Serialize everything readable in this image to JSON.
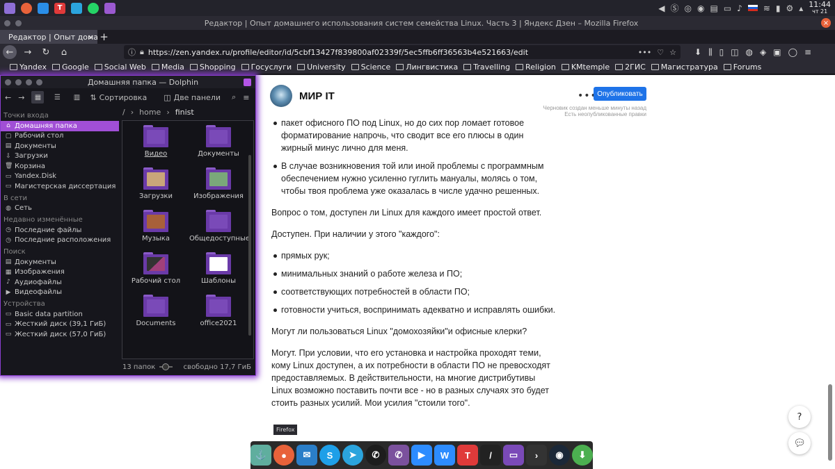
{
  "system_panel": {
    "clock_time": "11:44",
    "clock_day": "чт 21",
    "icons": [
      {
        "name": "app-menu-icon",
        "color": "#8e6fd6"
      },
      {
        "name": "firefox-icon",
        "color": "#e8623a"
      },
      {
        "name": "mail-icon",
        "color": "#2a8ee8"
      },
      {
        "name": "typora-icon",
        "color": "#e03a3a",
        "glyph": "T"
      },
      {
        "name": "telegram-icon",
        "color": "#2ba4dd"
      },
      {
        "name": "whatsapp-icon",
        "color": "#25d366"
      },
      {
        "name": "dolphin-icon",
        "color": "#9b59d0"
      }
    ]
  },
  "browser": {
    "window_title": "Редактор | Опыт домашнего использования систем семейства Linux. Часть 3 | Яндекс Дзен – Mozilla Firefox",
    "tab_title": "Редактор | Опыт домашнего",
    "url": "https://zen.yandex.ru/profile/editor/id/5cbf13427f839800af02339f/5ec5ffb6ff36563b4e521663/edit",
    "bookmarks": [
      "Yandex",
      "Google",
      "Social Web",
      "Media",
      "Shopping",
      "Госуслуги",
      "University",
      "Science",
      "Лингвистика",
      "Travelling",
      "Religion",
      "KMtemple",
      "2ГИС",
      "Магистратура",
      "Forums"
    ]
  },
  "page": {
    "site_name": "МИР IT",
    "publish_label": "Опубликовать",
    "draft_line1": "Черновик создан меньше минуты назад",
    "draft_line2": "Есть неопубликованные правки",
    "help_label": "?",
    "article": {
      "bullet_a": "пакет офисного ПО под Linux, но до сих пор ломает готовое форматирование напрочь, что сводит все его плюсы в один жирный минус лично для меня.",
      "bullet_b": "В случае возникновения той или иной проблемы с программным обеспечением нужно усиленно гуглить мануалы, молясь о том, чтобы твоя проблема уже оказалась в числе удачно решенных.",
      "p1": "Вопрос о том, доступен ли Linux для каждого имеет простой ответ.",
      "p2": "Доступен. При наличии у этого \"каждого\":",
      "list": [
        "прямых рук;",
        "минимальных знаний о работе железа и ПО;",
        "соответствующих потребностей в области ПО;",
        "готовности учиться, воспринимать адекватно и исправлять ошибки."
      ],
      "p3": "Могут ли пользоваться Linux \"домохозяйки\"и офисные клерки?",
      "p4": "Могут. При условии, что его установка и настройка проходят теми, кому Linux доступен, а их потребности в области ПО не превосходят предоставляемых. В действительности, на многие дистрибутивы Linux возможно поставить почти все - но в разных случаях это будет стоить разных усилий. Мои усилия \"стоили того\"."
    }
  },
  "dolphin": {
    "title": "Домашняя папка — Dolphin",
    "sort_label": "Сортировка",
    "split_label": "Две панели",
    "breadcrumb": {
      "root": "/",
      "home": "home",
      "current": "finist"
    },
    "sections": {
      "places": "Точки входа",
      "remote": "В сети",
      "recent": "Недавно изменённые",
      "search": "Поиск",
      "devices": "Устройства"
    },
    "places": [
      "Домашняя папка",
      "Рабочий стол",
      "Документы",
      "Загрузки",
      "Корзина",
      "Yandex.Disk",
      "Магистерская диссертация"
    ],
    "remote": [
      "Сеть"
    ],
    "recent": [
      "Последние файлы",
      "Последние расположения"
    ],
    "search": [
      "Документы",
      "Изображения",
      "Аудиофайлы",
      "Видеофайлы"
    ],
    "devices": [
      "Basic data partition",
      "Жесткий диск (39,1 ГиБ)",
      "Жесткий диск (57,0 ГиБ)"
    ],
    "files": [
      "Видео",
      "Документы",
      "Загрузки",
      "Изображения",
      "Музыка",
      "Общедоступные",
      "Рабочий стол",
      "Шаблоны",
      "Documents",
      "office2021"
    ],
    "status_count": "13 папок",
    "status_free": "свободно 17,7 ГиБ"
  },
  "tooltip": "Firefox",
  "dock": [
    {
      "name": "dock-anchor-icon",
      "color": "#5fae9e",
      "glyph": "⚓"
    },
    {
      "name": "dock-firefox-icon",
      "color": "#e8623a",
      "glyph": "●"
    },
    {
      "name": "dock-mail-icon",
      "color": "#2a7ec8",
      "glyph": "✉"
    },
    {
      "name": "dock-skype-icon",
      "color": "#1e9fe8",
      "glyph": "S"
    },
    {
      "name": "dock-telegram-icon",
      "color": "#2ba4dd",
      "glyph": "➤"
    },
    {
      "name": "dock-whatsapp-icon",
      "color": "#1d1d1d",
      "glyph": "✆"
    },
    {
      "name": "dock-viber-icon",
      "color": "#7b519d",
      "glyph": "✆"
    },
    {
      "name": "dock-zoom-icon",
      "color": "#2d8cff",
      "glyph": "▶"
    },
    {
      "name": "dock-writer-icon",
      "color": "#2d8cff",
      "glyph": "W"
    },
    {
      "name": "dock-typora-icon",
      "color": "#e03a3a",
      "glyph": "T"
    },
    {
      "name": "dock-editor-icon",
      "color": "#222",
      "glyph": "/"
    },
    {
      "name": "dock-dolphin-icon",
      "color": "#7a4ab8",
      "glyph": "▭"
    },
    {
      "name": "dock-terminal-icon",
      "color": "#333",
      "glyph": "›"
    },
    {
      "name": "dock-steam-icon",
      "color": "#1b2838",
      "glyph": "◉"
    },
    {
      "name": "dock-downloader-icon",
      "color": "#4caf50",
      "glyph": "⬇"
    }
  ]
}
